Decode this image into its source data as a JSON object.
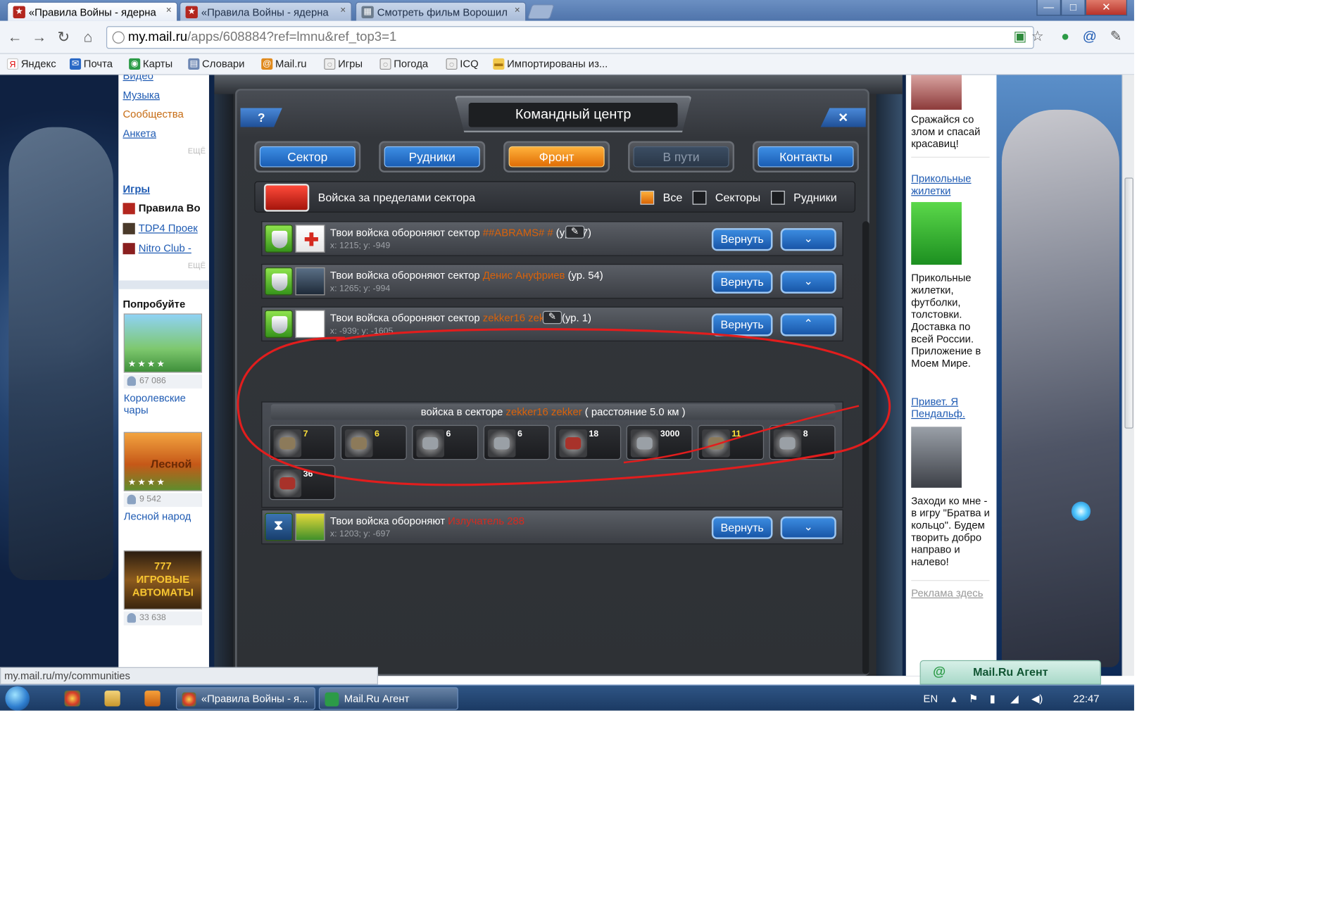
{
  "browser": {
    "tabs": [
      {
        "title": "«Правила Войны - ядерна",
        "close": "×",
        "active": true
      },
      {
        "title": "«Правила Войны - ядерна",
        "close": "×",
        "active": false
      },
      {
        "title": "Смотреть фильм Ворошил",
        "close": "×",
        "active": false
      }
    ],
    "window_controls": {
      "minimize": "—",
      "maximize": "□",
      "close": "✕"
    },
    "url_host": "my.mail.ru",
    "url_path": "/apps/608884?ref=lmnu&ref_top3=1",
    "bookmarks": [
      "Яндекс",
      "Почта",
      "Карты",
      "Словари",
      "Mail.ru",
      "Игры",
      "Погода",
      "ICQ",
      "Импортированы из..."
    ],
    "status_url": "my.mail.ru/my/communities"
  },
  "left_sidebar": {
    "top_links": [
      "Видео",
      "Музыка",
      "Сообщества",
      "Анкета"
    ],
    "more_label": "ЕЩЁ",
    "games_header": "Игры",
    "games": [
      "Правила Во",
      "TDP4 Проек",
      "Nitro Club -"
    ],
    "try_header": "Попробуйте",
    "promos": [
      {
        "count": "67 086",
        "title": "Королевские чары"
      },
      {
        "count": "9 542",
        "title": "Лесной народ",
        "img_text": "Лесной"
      },
      {
        "count": "33 638",
        "img_text": "777 ИГРОВЫЕ АВТОМАТЫ"
      }
    ]
  },
  "game": {
    "title": "Командный центр",
    "help_label": "?",
    "close_label": "✕",
    "tabs": [
      {
        "label": "Сектор",
        "state": "normal"
      },
      {
        "label": "Рудники",
        "state": "normal"
      },
      {
        "label": "Фронт",
        "state": "active"
      },
      {
        "label": "В пути",
        "state": "disabled"
      },
      {
        "label": "Контакты",
        "state": "normal"
      }
    ],
    "filter": {
      "label": "Войска за пределами сектора",
      "options": [
        {
          "label": "Все",
          "checked": true
        },
        {
          "label": "Секторы",
          "checked": false
        },
        {
          "label": "Рудники",
          "checked": false
        }
      ]
    },
    "rows": [
      {
        "prefix": "Твои войска обороняют сектор",
        "name": "##ABRAMS# #",
        "level": "(ур. 57)",
        "coords": "x: 1215; y: -949",
        "return": "Вернуть",
        "expand": "⌄"
      },
      {
        "prefix": "Твои войска обороняют сектор",
        "name": "Денис Ануфриев",
        "level": "(ур. 54)",
        "coords": "x: 1265; y: -994",
        "return": "Вернуть",
        "expand": "⌄"
      },
      {
        "prefix": "Твои войска обороняют сектор",
        "name": "zekker16 zekker",
        "level": "(ур. 1)",
        "coords": "x: -939; y: -1605",
        "return": "Вернуть",
        "expand": "⌃"
      },
      {
        "prefix": "Твои войска обороняют",
        "name": "Излучатель 288",
        "level": "",
        "coords": "x: 1203; y: -697",
        "return": "Вернуть",
        "expand": "⌄"
      }
    ],
    "troops": {
      "prefix": "войска в секторе",
      "name": "zekker16 zekker",
      "distance": "( расстояние 5.0 км )",
      "units": [
        "7",
        "6",
        "6",
        "6",
        "18",
        "3000",
        "11",
        "8",
        "36"
      ]
    }
  },
  "right_sidebar": {
    "items": [
      {
        "text": "Сражайся со злом и спасай красавиц!"
      },
      {
        "link": "Прикольные жилетки",
        "text": "Прикольные жилетки, футболки, толстовки. Доставка по всей России. Приложение в Моем Мире."
      },
      {
        "link": "Привет. Я Пендальф.",
        "text": "Заходи ко мне - в игру \"Братва и кольцо\". Будем творить добро направо и налево!"
      }
    ],
    "ad_link": "Реклама здесь"
  },
  "agent_label": "Mail.Ru Агент",
  "agent_icon": "@",
  "taskbar": {
    "tasks": [
      "«Правила Войны - я...",
      "Mail.Ru Агент"
    ],
    "lang": "EN",
    "time": "22:47"
  },
  "colors": {
    "accent_orange": "#e06d06",
    "button_blue": "#1856a8",
    "name_orange": "#d9620a"
  }
}
